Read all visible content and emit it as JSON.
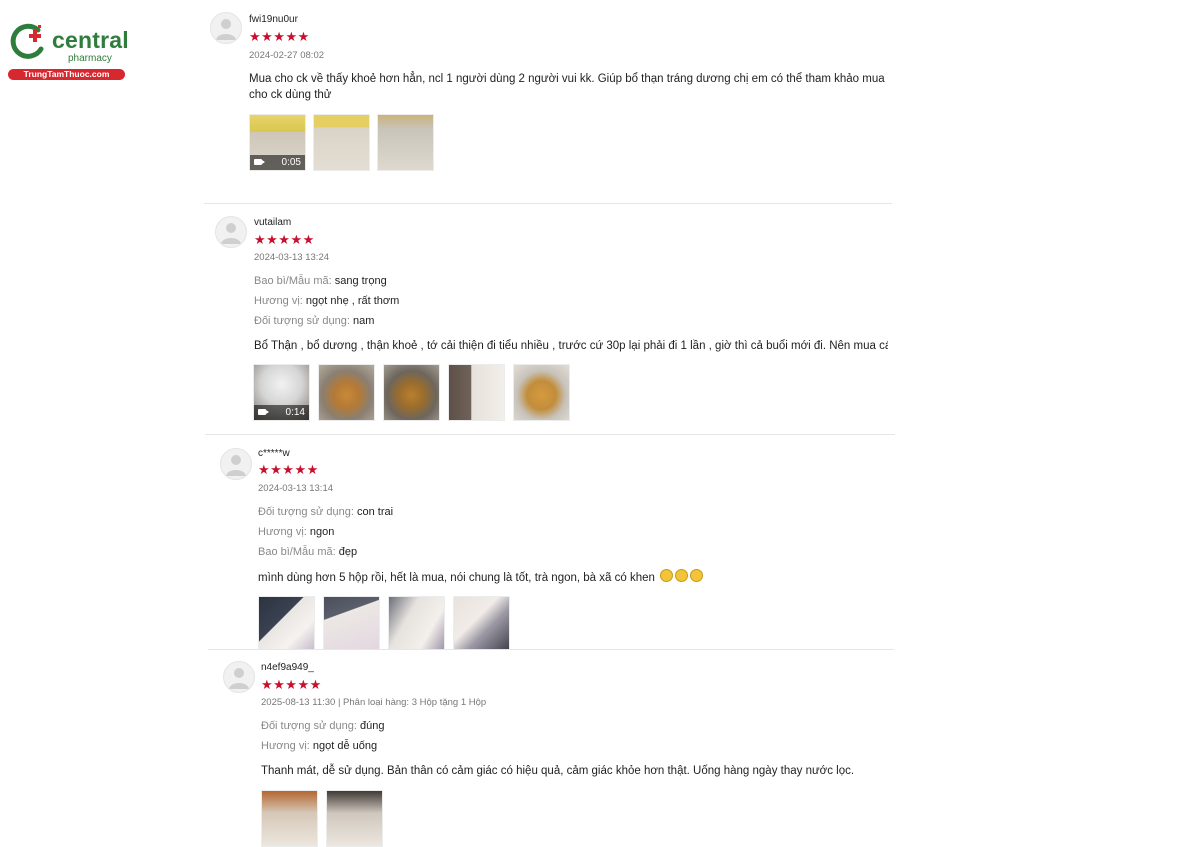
{
  "logo": {
    "name": "central",
    "sub": "pharmacy",
    "site": "TrungTamThuoc.com",
    "colors": {
      "green": "#2f7d3c",
      "red": "#d7282f"
    }
  },
  "star_color": "#c8102e",
  "reviews": [
    {
      "username": "fwi19nu0ur",
      "stars": "★★★★★",
      "date": "2024-02-27 08:02",
      "attributes": [],
      "comment": "Mua cho ck về thấy khoẻ hơn hẳn, ncl 1 người dùng 2 người vui kk. Giúp bổ thạn tráng dương chị em có thể tham khảo mua cho ck dùng thử",
      "video_duration": "0:05",
      "media_count": 3
    },
    {
      "username": "vutailam",
      "stars": "★★★★★",
      "date": "2024-03-13 13:24",
      "attributes": [
        {
          "label": "Bao bì/Mẫu mã:",
          "value": "sang trọng"
        },
        {
          "label": "Hương vị:",
          "value": "ngọt nhẹ , rất thơm"
        },
        {
          "label": "Đối tượng sử dụng:",
          "value": "nam"
        }
      ],
      "comment": "Bổ Thận , bổ dương , thận khoẻ , tớ cải thiện đi tiểu nhiều , trước cứ 30p lại phải đi 1 lần ,  giờ thì cả buổi mới đi. Nên mua các bạn à",
      "video_duration": "0:14",
      "media_count": 5
    },
    {
      "username": "c*****w",
      "stars": "★★★★★",
      "date": "2024-03-13 13:14",
      "attributes": [
        {
          "label": "Đối tượng sử dụng:",
          "value": "con trai"
        },
        {
          "label": "Hương vị:",
          "value": "ngon"
        },
        {
          "label": "Bao bì/Mẫu mã:",
          "value": "đẹp"
        }
      ],
      "comment": "mình dùng hơn 5 hộp rồi, hết là mua, nói chung là tốt, trà ngon, bà xã có khen",
      "media_count": 4
    },
    {
      "username": "n4ef9a949_",
      "stars": "★★★★★",
      "date": "2025-08-13 11:30 | Phân loại hàng: 3 Hộp tặng 1 Hộp",
      "attributes": [
        {
          "label": "Đối tượng sử dụng:",
          "value": "đúng"
        },
        {
          "label": "Hương vị:",
          "value": "ngọt dễ uống"
        }
      ],
      "comment": "Thanh mát, dễ sử dụng. Bản thân có cảm giác có hiệu quả, cảm giác khỏe hơn thật. Uống hàng ngày thay nước lọc.",
      "media_count": 2
    }
  ]
}
